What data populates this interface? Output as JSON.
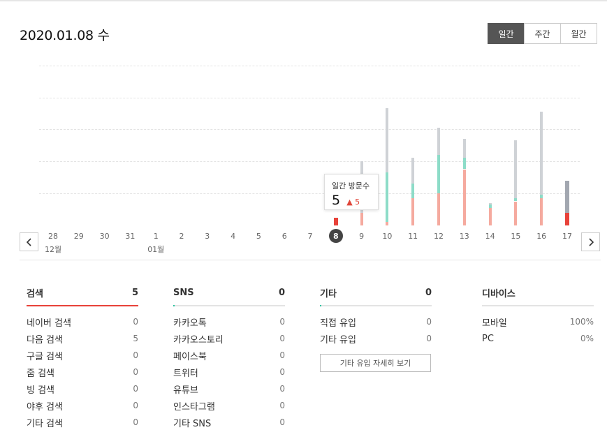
{
  "header": {
    "date": "2020.01.08 수",
    "period_tabs": [
      {
        "label": "일간",
        "active": true
      },
      {
        "label": "주간",
        "active": false
      },
      {
        "label": "월간",
        "active": false
      }
    ]
  },
  "chart_data": {
    "type": "bar",
    "categories": [
      "28",
      "29",
      "30",
      "31",
      "1",
      "2",
      "3",
      "4",
      "5",
      "6",
      "7",
      "8",
      "9",
      "10",
      "11",
      "12",
      "13",
      "14",
      "15",
      "16",
      "17"
    ],
    "month_labels": [
      {
        "label": "12월",
        "under_index": 0
      },
      {
        "label": "01월",
        "under_index": 4
      }
    ],
    "selected_index": 11,
    "series": [
      {
        "values": [
          0,
          0,
          0,
          0,
          0,
          0,
          0,
          0,
          0,
          0,
          0,
          5,
          8,
          2,
          17,
          20,
          35,
          11,
          15,
          17,
          8
        ]
      },
      {
        "values": [
          0,
          0,
          0,
          0,
          0,
          0,
          0,
          0,
          0,
          0,
          0,
          0,
          0,
          31,
          9,
          24,
          7,
          2,
          2,
          2,
          0
        ]
      },
      {
        "values": [
          0,
          0,
          0,
          0,
          0,
          0,
          0,
          0,
          0,
          0,
          0,
          0,
          32,
          40,
          16,
          17,
          12,
          1,
          36,
          52,
          20
        ]
      }
    ],
    "colors": {
      "red": "#f5aa9f",
      "teal": "#8ddcc8",
      "gray": "#cfd2d6",
      "selected_red": "#e8423a",
      "selected_gray": "#a2a7b0"
    },
    "ymax": 100,
    "grid": true,
    "tooltip": {
      "label": "일간 방문수",
      "value": "5",
      "delta": "5"
    }
  },
  "nav": {
    "prev_icon": "chevron-left-icon",
    "next_icon": "chevron-right-icon"
  },
  "panels": {
    "search": {
      "title": "검색",
      "total": "5",
      "rows": [
        {
          "label": "네이버 검색",
          "value": "0"
        },
        {
          "label": "다음 검색",
          "value": "5"
        },
        {
          "label": "구글 검색",
          "value": "0"
        },
        {
          "label": "줌 검색",
          "value": "0"
        },
        {
          "label": "빙 검색",
          "value": "0"
        },
        {
          "label": "야후 검색",
          "value": "0"
        },
        {
          "label": "기타 검색",
          "value": "0"
        }
      ]
    },
    "sns": {
      "title": "SNS",
      "total": "0",
      "rows": [
        {
          "label": "카카오톡",
          "value": "0"
        },
        {
          "label": "카카오스토리",
          "value": "0"
        },
        {
          "label": "페이스북",
          "value": "0"
        },
        {
          "label": "트위터",
          "value": "0"
        },
        {
          "label": "유튜브",
          "value": "0"
        },
        {
          "label": "인스타그램",
          "value": "0"
        },
        {
          "label": "기타 SNS",
          "value": "0"
        }
      ]
    },
    "etc": {
      "title": "기타",
      "total": "0",
      "rows": [
        {
          "label": "직접 유입",
          "value": "0"
        },
        {
          "label": "기타 유입",
          "value": "0"
        }
      ],
      "detail_button": "기타 유입 자세히 보기"
    },
    "device": {
      "title": "디바이스",
      "rows": [
        {
          "label": "모바일",
          "value": "100%"
        },
        {
          "label": "PC",
          "value": "0%"
        }
      ]
    }
  },
  "accent_colors": {
    "search": "#e8423a",
    "sns": "#2bc4a0",
    "etc": "#2bc4a0"
  }
}
